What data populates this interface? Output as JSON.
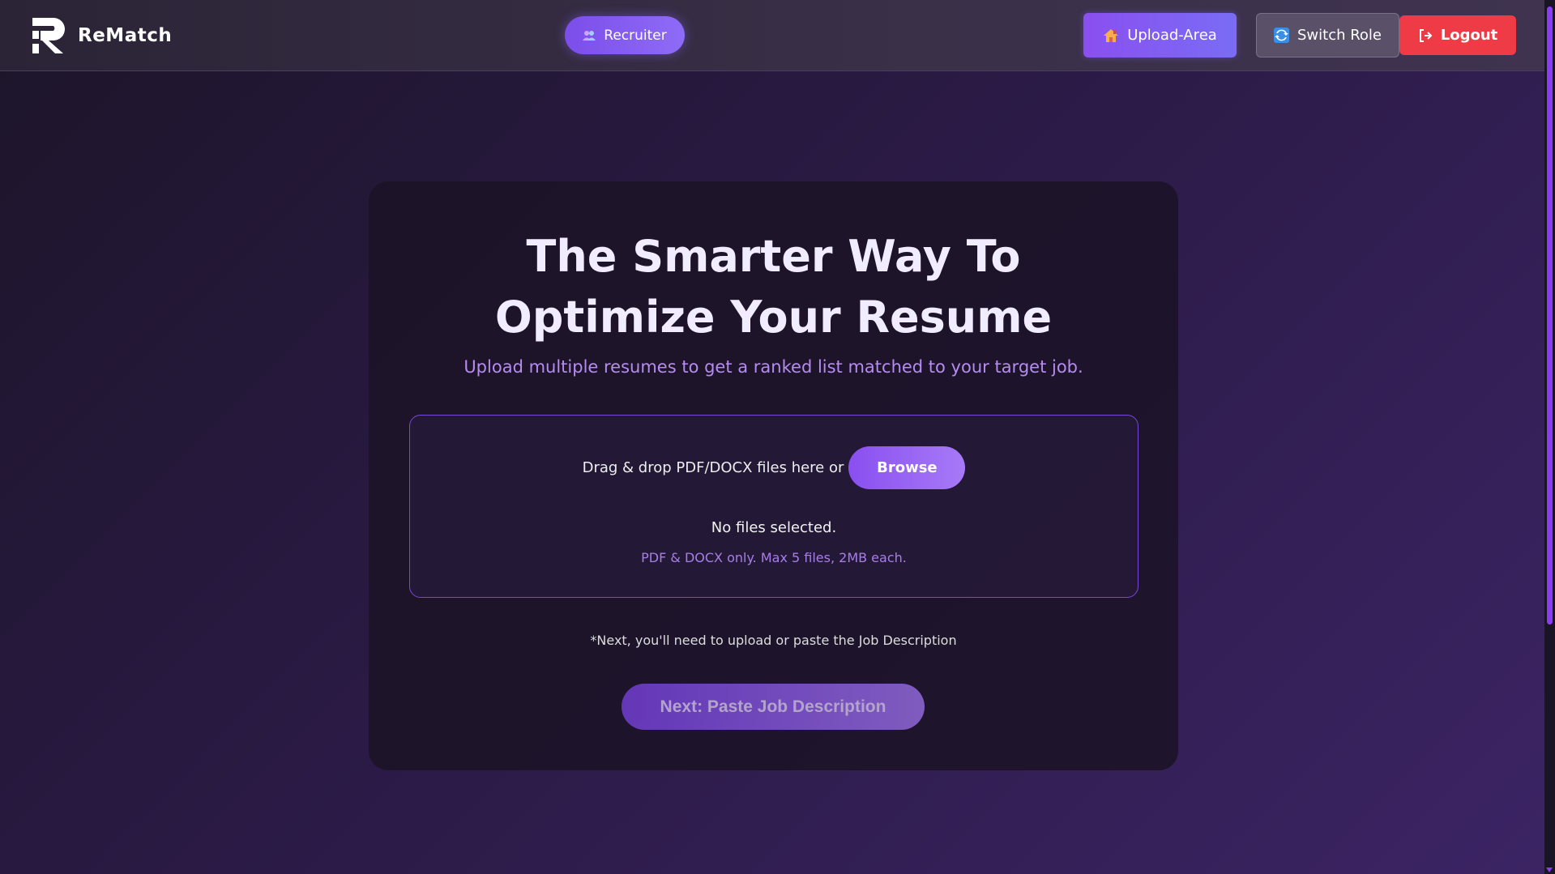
{
  "navbar": {
    "brand_name": "ReMatch",
    "role_badge": "Recruiter",
    "upload_area_label": "Upload-Area",
    "switch_role_label": "Switch Role",
    "logout_label": "Logout"
  },
  "hero": {
    "headline_line1": "The Smarter Way To",
    "headline_line2": "Optimize Your Resume",
    "subline": "Upload multiple resumes to get a ranked list matched to your target job."
  },
  "dropzone": {
    "drop_text": "Drag & drop PDF/DOCX files here or",
    "browse_label": "Browse",
    "status": "No files selected.",
    "limits": "PDF & DOCX only. Max 5 files, 2MB each."
  },
  "footer": {
    "note": "*Next, you'll need to upload or paste the Job Description",
    "next_button_label": "Next: Paste Job Description"
  },
  "colors": {
    "accent": "#8a4ff0",
    "danger": "#ef3b45",
    "subtext": "#b58cf0"
  },
  "icons": {
    "brand": "rematch-logo",
    "recruiter": "users-icon",
    "upload_area": "house-icon",
    "switch_role": "switch-icon",
    "logout": "logout-icon"
  }
}
